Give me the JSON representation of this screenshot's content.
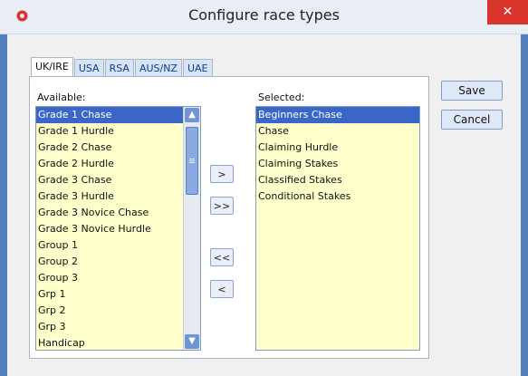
{
  "window": {
    "title": "Configure race types",
    "close_label": "✕"
  },
  "tabs": [
    "UK/IRE",
    "USA",
    "RSA",
    "AUS/NZ",
    "UAE"
  ],
  "available": {
    "label": "Available:",
    "items": [
      "Grade 1 Chase",
      "Grade 1 Hurdle",
      "Grade 2 Chase",
      "Grade 2 Hurdle",
      "Grade 3 Chase",
      "Grade 3 Hurdle",
      "Grade 3 Novice Chase",
      "Grade 3 Novice Hurdle",
      "Group 1",
      "Group 2",
      "Group 3",
      "Grp 1",
      "Grp 2",
      "Grp 3",
      "Handicap"
    ],
    "selected_item": "Grade 1 Chase"
  },
  "selected": {
    "label": "Selected:",
    "items": [
      "Beginners Chase",
      "Chase",
      "Claiming Hurdle",
      "Claiming Stakes",
      "Classified Stakes",
      "Conditional Stakes"
    ],
    "selected_item": "Beginners Chase"
  },
  "move_buttons": {
    "add": ">",
    "add_all": ">>",
    "remove_all": "<<",
    "remove": "<"
  },
  "actions": {
    "save": "Save",
    "cancel": "Cancel"
  },
  "colors": {
    "accent": "#3a66c8",
    "list_bg": "#ffffcc",
    "close": "#d9352c"
  }
}
